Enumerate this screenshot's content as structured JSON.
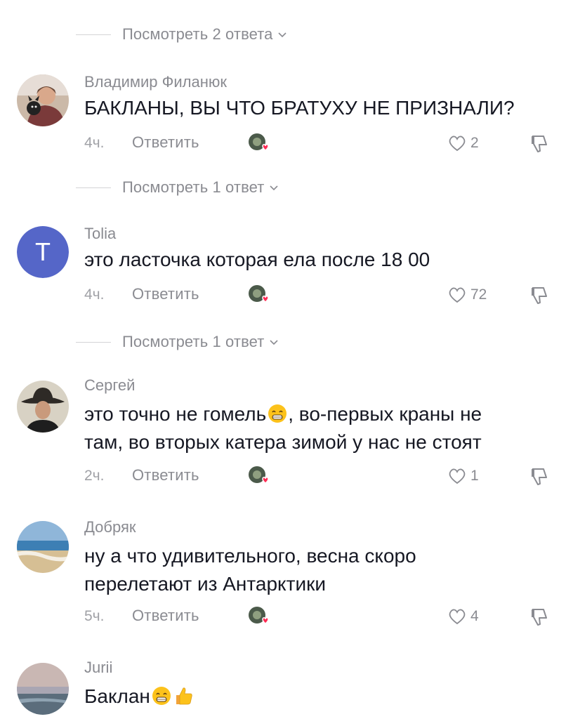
{
  "reply_toggles": [
    "Посмотреть 2 ответа",
    "Посмотреть 1 ответ",
    "Посмотреть 1 ответ"
  ],
  "reply_label": "Ответить",
  "comments": [
    {
      "username": "Владимир Филанюк",
      "text": "БАКЛАНЫ, ВЫ ЧТО БРАТУХУ НЕ ПРИЗНАЛИ?",
      "time": "4ч.",
      "likes": "2"
    },
    {
      "username": "Tolia",
      "avatar_letter": "T",
      "text": "это ласточка которая ела после 18 00",
      "time": "4ч.",
      "likes": "72"
    },
    {
      "username": "Сергей",
      "text_line1": "это точно не гомель",
      "text_line1_after": ", во-первых краны не",
      "text_line2": "там, во вторых катера зимой у нас не стоят",
      "time": "2ч.",
      "likes": "1"
    },
    {
      "username": "Добряк",
      "text_line1": "ну а что удивительного, весна скоро",
      "text_line2": "перелетают из Антарктики",
      "time": "5ч.",
      "likes": "4"
    },
    {
      "username": "Jurii",
      "text": "Баклан"
    }
  ],
  "colors": {
    "text": "#161823",
    "muted": "#8a8b91",
    "avatar_t": "#5566c8",
    "creator_heart": "#fe2c55"
  },
  "icons": [
    "chevron-down-icon",
    "heart-outline-icon",
    "dislike-icon",
    "creator-liked-icon",
    "grin-emoji",
    "thumbs-up-emoji"
  ]
}
